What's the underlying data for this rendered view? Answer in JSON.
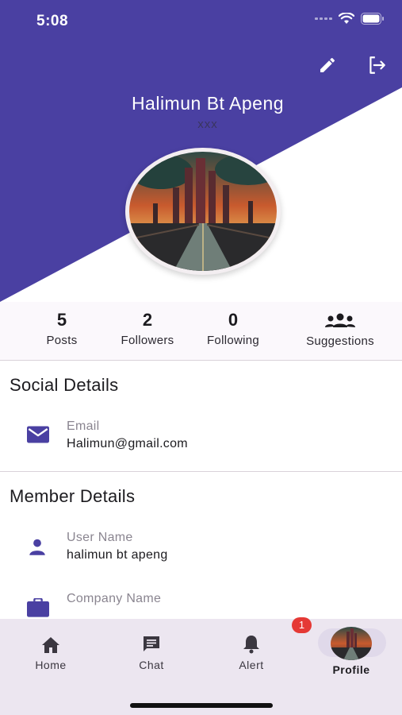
{
  "status_bar": {
    "time": "5:08"
  },
  "header": {
    "name": "Halimun Bt Apeng",
    "subtitle": "xxx",
    "colors": {
      "primary": "#4a40a2",
      "white": "#ffffff"
    },
    "actions": {
      "edit_icon": "pencil-icon",
      "logout_icon": "logout-icon"
    }
  },
  "stats": {
    "posts": {
      "value": "5",
      "label": "Posts"
    },
    "followers": {
      "value": "2",
      "label": "Followers"
    },
    "following": {
      "value": "0",
      "label": "Following"
    },
    "suggestions": {
      "label": "Suggestions",
      "icon": "group-icon"
    }
  },
  "social": {
    "title": "Social Details",
    "email": {
      "label": "Email",
      "value": "Halimun@gmail.com",
      "icon": "mail-icon"
    }
  },
  "member": {
    "title": "Member Details",
    "username": {
      "label": "User Name",
      "value": "halimun bt apeng",
      "icon": "person-icon"
    },
    "company": {
      "label": "Company Name",
      "icon": "briefcase-icon"
    }
  },
  "nav": {
    "home": "Home",
    "chat": "Chat",
    "alert": "Alert",
    "profile": "Profile",
    "badge_count": "1"
  }
}
